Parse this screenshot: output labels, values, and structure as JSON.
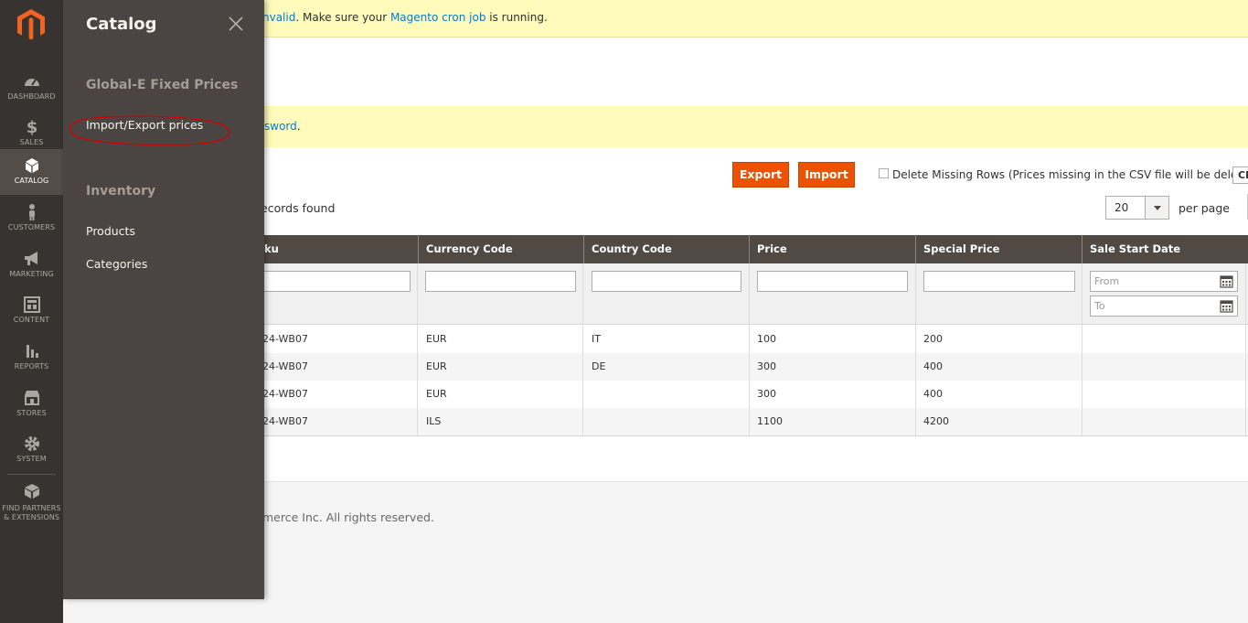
{
  "nav": [
    {
      "label": "DASHBOARD",
      "icon": "dashboard-icon"
    },
    {
      "label": "SALES",
      "icon": "dollar-icon"
    },
    {
      "label": "CATALOG",
      "icon": "box-icon"
    },
    {
      "label": "CUSTOMERS",
      "icon": "person-icon"
    },
    {
      "label": "MARKETING",
      "icon": "megaphone-icon"
    },
    {
      "label": "CONTENT",
      "icon": "layout-icon"
    },
    {
      "label": "REPORTS",
      "icon": "bar-chart-icon"
    },
    {
      "label": "STORES",
      "icon": "store-icon"
    },
    {
      "label": "SYSTEM",
      "icon": "gear-icon"
    },
    {
      "label1": "FIND PARTNERS",
      "label2": "& EXTENSIONS",
      "icon": "extensions-icon"
    }
  ],
  "flyout": {
    "title": "Catalog",
    "group1": "Global-E Fixed Prices",
    "group1_link": "Import/Export prices",
    "group2": "Inventory",
    "group2_links": [
      "Products",
      "Categories"
    ]
  },
  "system_message": {
    "pre": "nvalid",
    "mid": ". Make sure your ",
    "link": "Magento cron job",
    "post": " is running."
  },
  "notice": {
    "link": "sword",
    "post": "."
  },
  "toolbar": {
    "export_label": "Export",
    "import_label": "Import",
    "delete_missing_label": "Delete Missing Rows (Prices missing in the CSV file will be deleted)",
    "clipped_button": "Cl"
  },
  "grid": {
    "records_found": "ecords found",
    "per_page_value": "20",
    "per_page_label": "per page",
    "columns": [
      "Sku",
      "Currency Code",
      "Country Code",
      "Price",
      "Special Price",
      "Sale Start Date"
    ],
    "sku_visible_prefix": "ku",
    "date_from_placeholder": "From",
    "date_to_placeholder": "To",
    "rows": [
      {
        "sku": "24-WB07",
        "currency": "EUR",
        "country": "IT",
        "price": "100",
        "special": "200",
        "sale_start": ""
      },
      {
        "sku": "24-WB07",
        "currency": "EUR",
        "country": "DE",
        "price": "300",
        "special": "400",
        "sale_start": ""
      },
      {
        "sku": "24-WB07",
        "currency": "EUR",
        "country": "",
        "price": "300",
        "special": "400",
        "sale_start": ""
      },
      {
        "sku": "24-WB07",
        "currency": "ILS",
        "country": "",
        "price": "1100",
        "special": "4200",
        "sale_start": ""
      }
    ]
  },
  "footer": {
    "text": "merce Inc. All rights reserved."
  },
  "colors": {
    "accent": "#eb5202",
    "sidebar": "#373330",
    "flyout": "#4a4542",
    "grid_header": "#514943",
    "notice_bg": "#fffbbb",
    "link": "#007bdb",
    "annotation": "#d40000"
  }
}
